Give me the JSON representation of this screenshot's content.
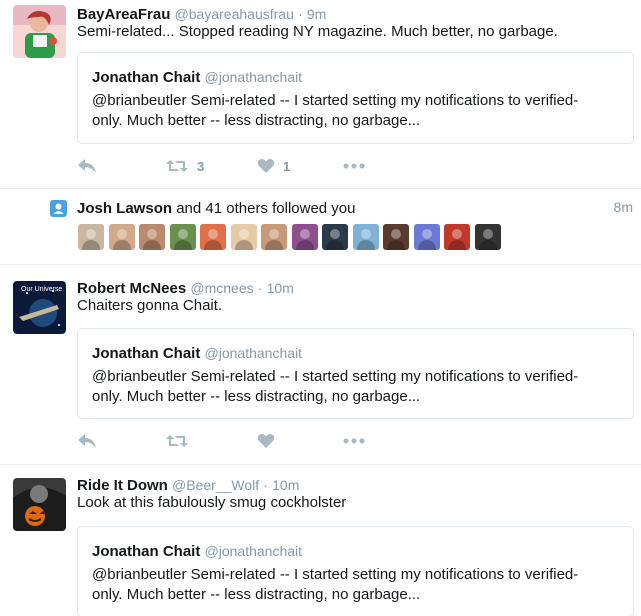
{
  "tweets": [
    {
      "name": "BayAreaFrau",
      "handle": "@bayareahausfrau",
      "dot": "·",
      "time": "9m",
      "text": "Semi-related... Stopped reading NY magazine.  Much better, no garbage.",
      "quote": {
        "name": "Jonathan Chait",
        "handle": "@jonathanchait",
        "line1": "@brianbeutler Semi-related -- I started setting my notifications to verified-",
        "line2": "only. Much better -- less distracting, no garbage..."
      },
      "retweet_count": "3",
      "like_count": "1"
    },
    {
      "name": "Robert McNees",
      "handle": "@mcnees",
      "dot": "·",
      "time": "10m",
      "avatar_caption": "Our Universe",
      "text": "Chaiters gonna Chait.",
      "quote": {
        "name": "Jonathan Chait",
        "handle": "@jonathanchait",
        "line1": "@brianbeutler Semi-related -- I started setting my notifications to verified-",
        "line2": "only. Much better -- less distracting, no garbage..."
      }
    },
    {
      "name": "Ride It Down",
      "handle": "@Beer__Wolf",
      "dot": "·",
      "time": "10m",
      "text": "Look at this fabulously smug cockholster",
      "quote": {
        "name": "Jonathan Chait",
        "handle": "@jonathanchait",
        "line1": "@brianbeutler Semi-related -- I started setting my notifications to verified-",
        "line2": "only. Much better -- less distracting, no garbage..."
      }
    }
  ],
  "notification": {
    "icon": "person-icon",
    "name": "Josh Lawson",
    "rest": " and 41 others followed you",
    "time": "8m",
    "follower_colors": [
      "#c9b7a3",
      "#d3a98b",
      "#b98a6e",
      "#6b8f4e",
      "#e0704a",
      "#e8c9a8",
      "#c79a7b",
      "#8e4f8f",
      "#2b3a4a",
      "#7fb3d5",
      "#5a3b2e",
      "#6b7bd1",
      "#c0392b",
      "#333333"
    ]
  },
  "colors": {
    "muted": "#8899a6",
    "border": "#e1e8ed",
    "accent": "#4aa3df"
  }
}
